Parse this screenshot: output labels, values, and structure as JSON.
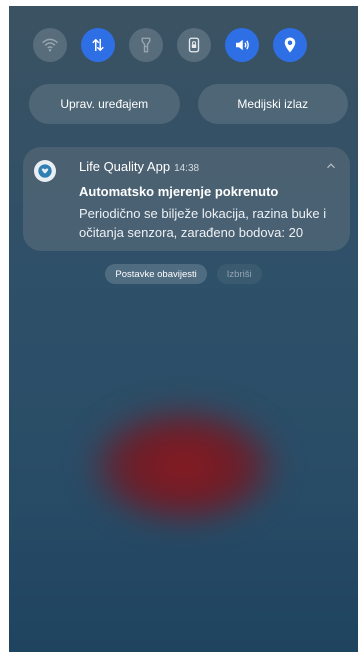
{
  "quick_toggles": [
    {
      "icon": "wifi-icon",
      "state": "off"
    },
    {
      "icon": "data-transfer-icon",
      "state": "on"
    },
    {
      "icon": "flashlight-icon",
      "state": "off"
    },
    {
      "icon": "screen-lock-icon",
      "state": "off"
    },
    {
      "icon": "volume-icon",
      "state": "on"
    },
    {
      "icon": "location-icon",
      "state": "on"
    }
  ],
  "media_pills": {
    "device_control": "Uprav. uređajem",
    "media_output": "Medijski izlaz"
  },
  "notification": {
    "app_name": "Life Quality App",
    "time": "14:38",
    "title": "Automatsko mjerenje pokrenuto",
    "body": "Periodično se bilježe lokacija, razina buke i očitanja senzora, zarađeno bodova: 20"
  },
  "actions": {
    "settings_label": "Postavke obavijesti",
    "clear_label": "Izbriši"
  },
  "colors": {
    "accent": "#2f6fe6",
    "background_top": "#3b5262",
    "background_bottom": "#1f4460"
  }
}
